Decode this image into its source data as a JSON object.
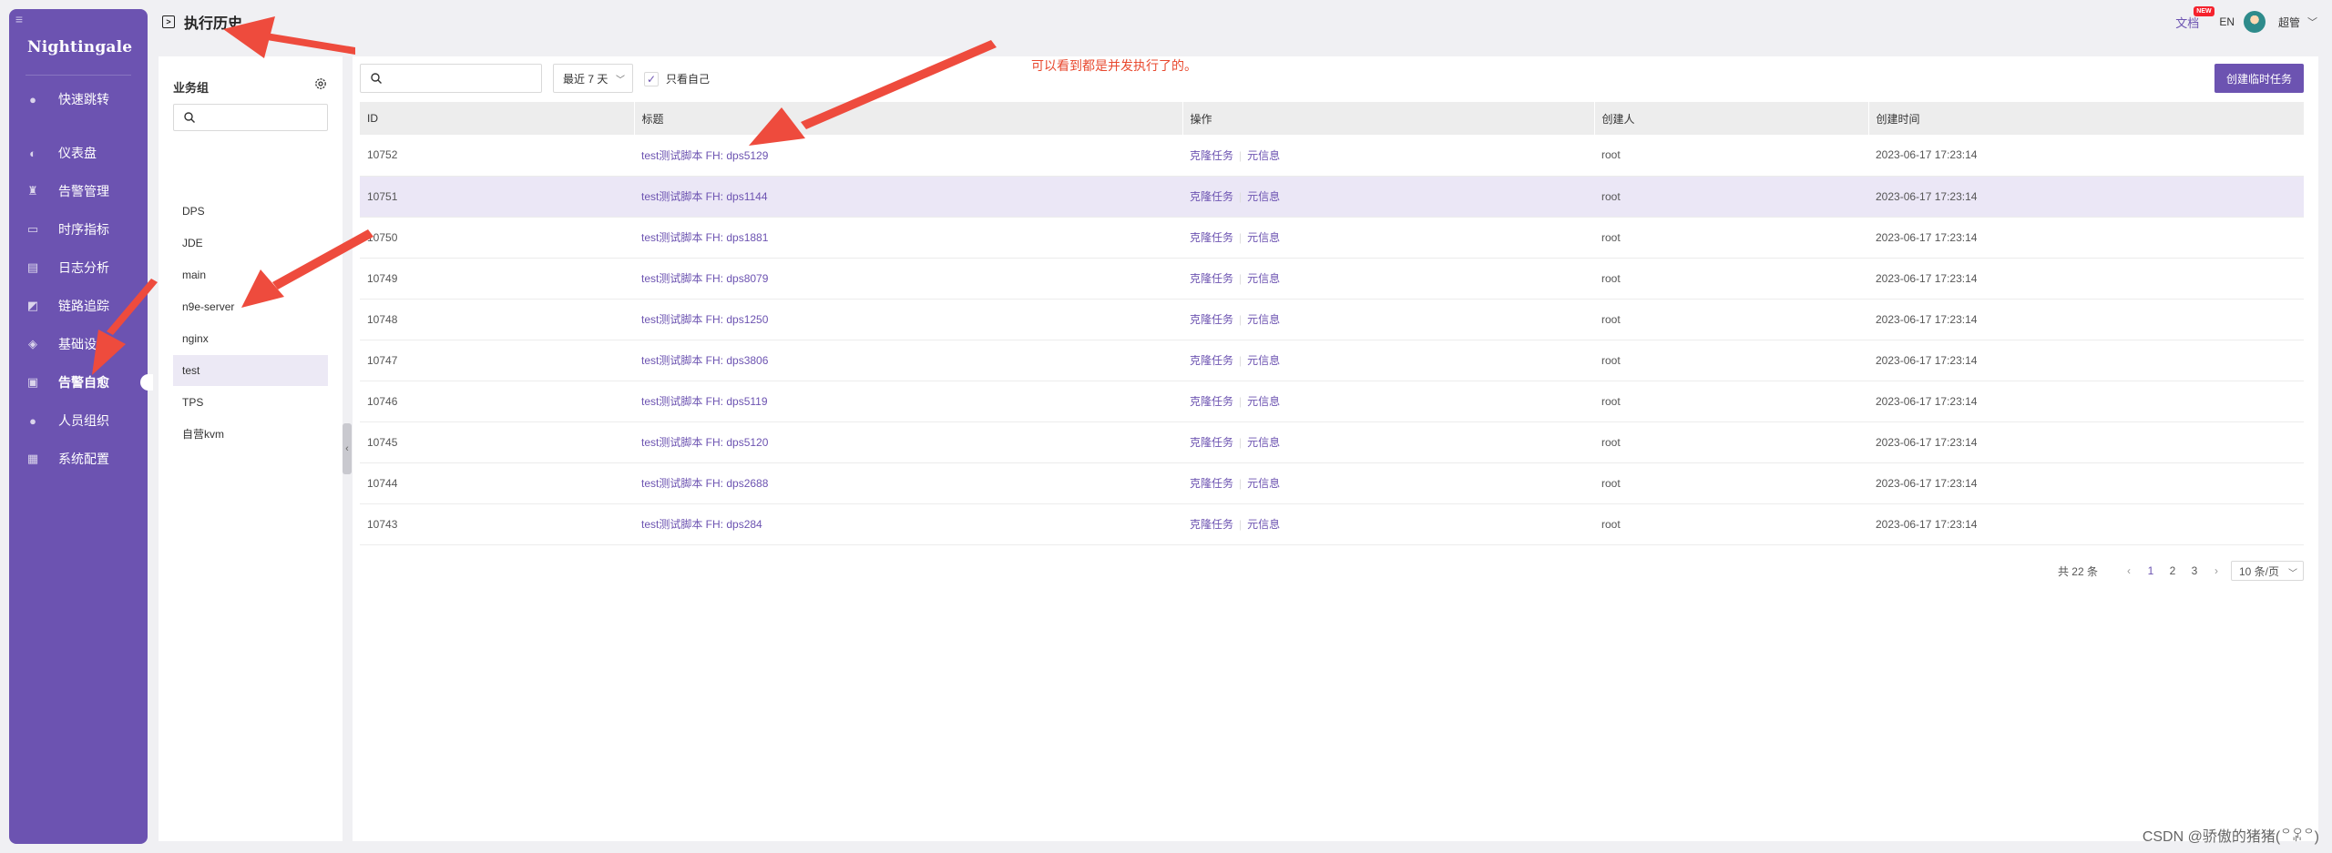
{
  "sidebar": {
    "logo_text": "Nightingale",
    "items": [
      {
        "label": "快速跳转",
        "icon": "search-icon"
      },
      {
        "label": "仪表盘",
        "icon": "dashboard-icon"
      },
      {
        "label": "告警管理",
        "icon": "alarm-icon"
      },
      {
        "label": "时序指标",
        "icon": "line-chart-icon"
      },
      {
        "label": "日志分析",
        "icon": "document-icon"
      },
      {
        "label": "链路追踪",
        "icon": "trace-icon"
      },
      {
        "label": "基础设施",
        "icon": "infrastructure-icon"
      },
      {
        "label": "告警自愈",
        "icon": "terminal-icon",
        "active": true
      },
      {
        "label": "人员组织",
        "icon": "user-icon"
      },
      {
        "label": "系统配置",
        "icon": "settings-grid-icon"
      }
    ]
  },
  "header": {
    "title": "执行历史",
    "docs_label": "文档",
    "new_badge": "NEW",
    "lang": "EN",
    "username": "超管"
  },
  "groups": {
    "title": "业务组",
    "items": [
      "DPS",
      "JDE",
      "main",
      "n9e-server",
      "nginx",
      "test",
      "TPS",
      "自营kvm"
    ],
    "selected": "test"
  },
  "toolbar": {
    "search_placeholder": "",
    "range": "最近 7 天",
    "only_mine_label": "只看自己",
    "only_mine_checked": true,
    "create_label": "创建临时任务"
  },
  "annotation": "可以看到都是并发执行了的。",
  "table": {
    "columns": [
      "ID",
      "标题",
      "操作",
      "创建人",
      "创建时间"
    ],
    "action_clone": "克隆任务",
    "action_meta": "元信息",
    "rows": [
      {
        "id": "10752",
        "title": "test测试脚本 FH: dps5129",
        "creator": "root",
        "created": "2023-06-17 17:23:14"
      },
      {
        "id": "10751",
        "title": "test测试脚本 FH: dps1144",
        "creator": "root",
        "created": "2023-06-17 17:23:14"
      },
      {
        "id": "10750",
        "title": "test测试脚本 FH: dps1881",
        "creator": "root",
        "created": "2023-06-17 17:23:14"
      },
      {
        "id": "10749",
        "title": "test测试脚本 FH: dps8079",
        "creator": "root",
        "created": "2023-06-17 17:23:14"
      },
      {
        "id": "10748",
        "title": "test测试脚本 FH: dps1250",
        "creator": "root",
        "created": "2023-06-17 17:23:14"
      },
      {
        "id": "10747",
        "title": "test测试脚本 FH: dps3806",
        "creator": "root",
        "created": "2023-06-17 17:23:14"
      },
      {
        "id": "10746",
        "title": "test测试脚本 FH: dps5119",
        "creator": "root",
        "created": "2023-06-17 17:23:14"
      },
      {
        "id": "10745",
        "title": "test测试脚本 FH: dps5120",
        "creator": "root",
        "created": "2023-06-17 17:23:14"
      },
      {
        "id": "10744",
        "title": "test测试脚本 FH: dps2688",
        "creator": "root",
        "created": "2023-06-17 17:23:14"
      },
      {
        "id": "10743",
        "title": "test测试脚本 FH: dps284",
        "creator": "root",
        "created": "2023-06-17 17:23:14"
      }
    ]
  },
  "pagination": {
    "total": "共 22 条",
    "pages": [
      "1",
      "2",
      "3"
    ],
    "current": "1",
    "page_size": "10 条/页"
  },
  "watermark": "CSDN @骄傲的猪猪(꒪ꄳ꒪)",
  "colors": {
    "brand": "#6c53b1",
    "annotation_arrow": "#ee4b3d",
    "highlight_row": "#ebe7f6"
  }
}
